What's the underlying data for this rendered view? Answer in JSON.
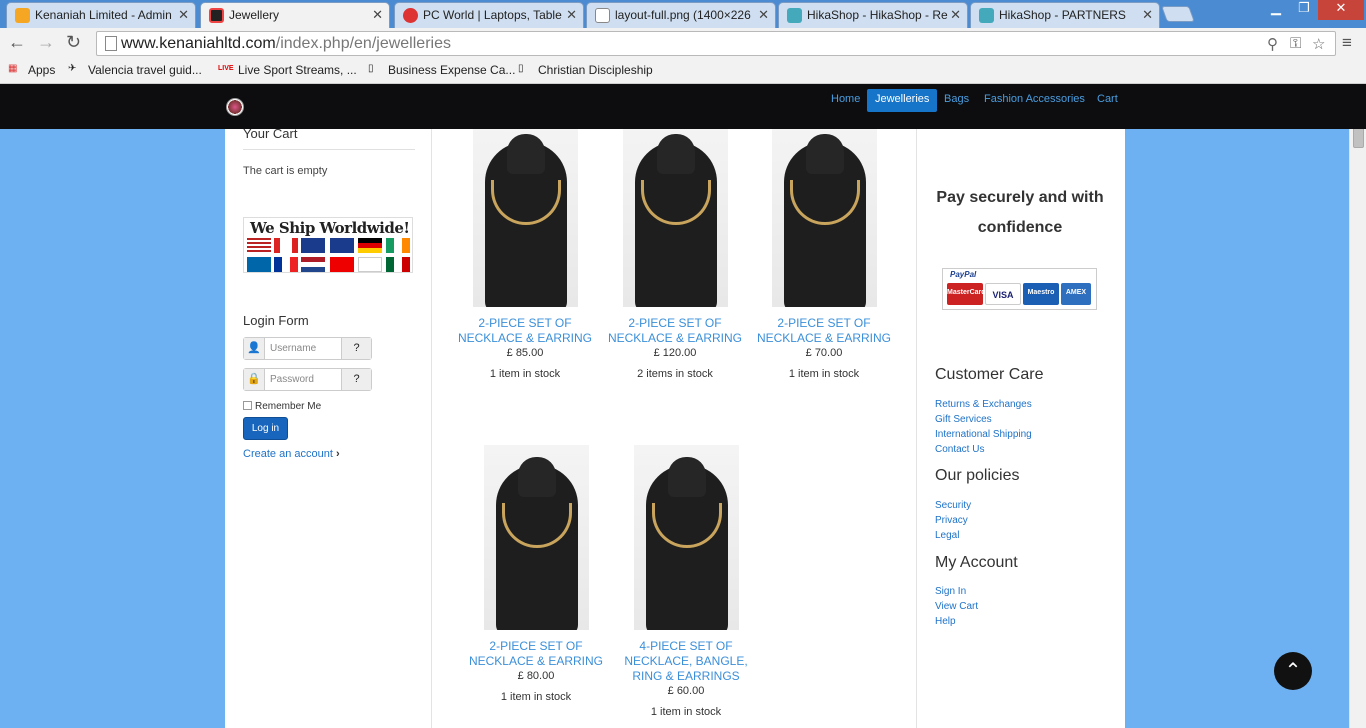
{
  "browser": {
    "tabs": [
      {
        "label": "Kenaniah Limited - Admin",
        "left": 0
      },
      {
        "label": "Jewellery"
      },
      {
        "label": "PC World | Laptops, Table"
      },
      {
        "label": "layout-full.png (1400×226"
      },
      {
        "label": "HikaShop - HikaShop - Re"
      },
      {
        "label": "HikaShop - PARTNERS"
      }
    ],
    "url_host": "www.kenaniahltd.com",
    "url_path": "/index.php/en/jewelleries",
    "bookmarks": [
      "Apps",
      "Valencia travel guid...",
      "Live Sport Streams, ...",
      "Business Expense Ca...",
      "Christian Discipleship"
    ]
  },
  "nav": {
    "items": [
      "Home",
      "Jewelleries",
      "Bags",
      "Fashion Accessories",
      "Cart"
    ],
    "active": "Jewelleries"
  },
  "sidebar": {
    "cart_title": "Your Cart",
    "cart_empty": "The cart is empty",
    "ship_title": "We Ship Worldwide!",
    "login_title": "Login Form",
    "username_placeholder": "Username",
    "password_placeholder": "Password",
    "remember_label": "Remember Me",
    "login_button": "Log in",
    "create_account": "Create an account"
  },
  "products": [
    {
      "name": "2-PIECE SET OF NECKLACE & EARRING",
      "price": "£ 85.00",
      "stock": "1 item in stock"
    },
    {
      "name": "2-PIECE SET OF NECKLACE & EARRING",
      "price": "£ 120.00",
      "stock": "2 items in stock"
    },
    {
      "name": "2-PIECE SET OF NECKLACE & EARRING",
      "price": "£ 70.00",
      "stock": "1 item in stock"
    },
    {
      "name": "2-PIECE SET OF NECKLACE & EARRING",
      "price": "£ 80.00",
      "stock": "1 item in stock"
    },
    {
      "name": "4-PIECE SET OF NECKLACE, BANGLE, RING & EARRINGS",
      "price": "£ 60.00",
      "stock": "1 item in stock"
    }
  ],
  "right": {
    "pay_title": "Pay securely and with confidence",
    "paypal": "PayPal",
    "cards": [
      "MasterCard",
      "VISA",
      "Maestro",
      "AMEX"
    ],
    "customer_care_title": "Customer Care",
    "customer_care_links": [
      "Returns & Exchanges",
      "Gift Services",
      "International Shipping",
      "Contact Us"
    ],
    "policies_title": "Our policies",
    "policies_links": [
      "Security",
      "Privacy",
      "Legal"
    ],
    "account_title": "My Account",
    "account_links": [
      "Sign In",
      "View Cart",
      "Help"
    ]
  }
}
